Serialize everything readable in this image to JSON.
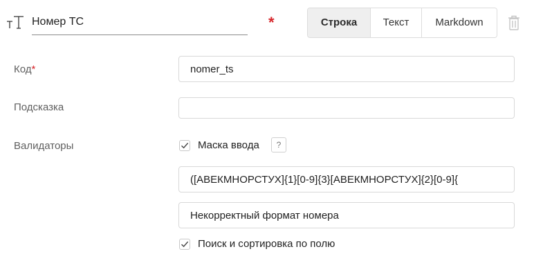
{
  "header": {
    "field_title": "Номер ТС",
    "required_mark": "*",
    "type_icon": "text-type-icon",
    "segments": [
      {
        "label": "Строка",
        "active": true
      },
      {
        "label": "Текст",
        "active": false
      },
      {
        "label": "Markdown",
        "active": false
      }
    ],
    "delete_icon": "trash-icon"
  },
  "form": {
    "code_label": "Код",
    "code_required": "*",
    "code_value": "nomer_ts",
    "hint_label": "Подсказка",
    "hint_value": "",
    "validators_label": "Валидаторы",
    "mask_checkbox_label": "Маска ввода",
    "mask_checked": true,
    "help_icon": "question-icon",
    "mask_value": "([АВЕКМНОРСТУХ]{1}[0-9]{3}[АВЕКМНОРСТУХ]{2}[0-9]{",
    "error_message": "Некорректный формат номера",
    "search_checkbox_label": "Поиск и сортировка по полю",
    "search_checked": true
  },
  "colors": {
    "required": "#d7262b",
    "active_segment_bg": "#efefef",
    "border": "#d8d8d8"
  }
}
